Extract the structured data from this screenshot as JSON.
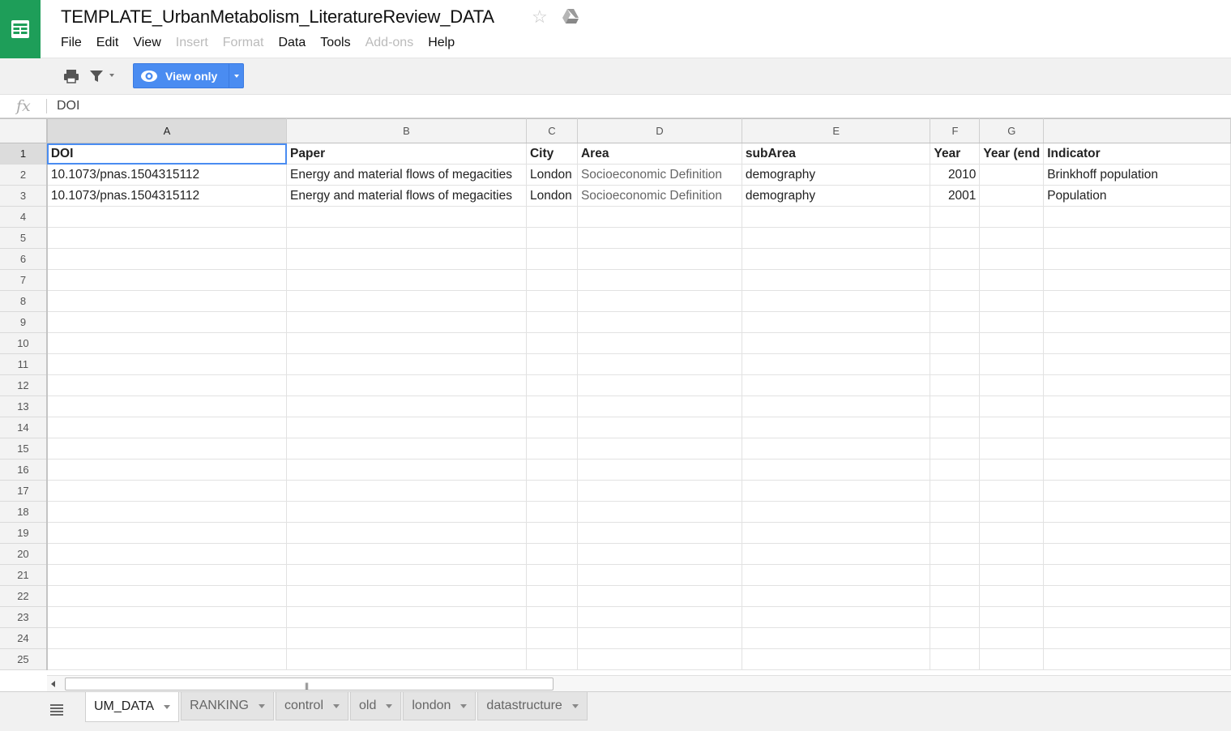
{
  "document": {
    "title": "TEMPLATE_UrbanMetabolism_LiteratureReview_DATA"
  },
  "menu": [
    {
      "label": "File",
      "disabled": false
    },
    {
      "label": "Edit",
      "disabled": false
    },
    {
      "label": "View",
      "disabled": false
    },
    {
      "label": "Insert",
      "disabled": true
    },
    {
      "label": "Format",
      "disabled": true
    },
    {
      "label": "Data",
      "disabled": false
    },
    {
      "label": "Tools",
      "disabled": false
    },
    {
      "label": "Add-ons",
      "disabled": true
    },
    {
      "label": "Help",
      "disabled": false
    }
  ],
  "toolbar": {
    "icons": [
      "print-icon",
      "filter-icon"
    ],
    "view_only_label": "View only",
    "accent_color": "#4a8cf1"
  },
  "formula_bar": {
    "fx_label": "fx",
    "value": "DOI"
  },
  "grid": {
    "columns": [
      "A",
      "B",
      "C",
      "D",
      "E",
      "F",
      "G",
      ""
    ],
    "selected_column": "A",
    "selected_row": "1",
    "row_numbers": [
      "1",
      "2",
      "3",
      "4",
      "5",
      "6",
      "7",
      "8",
      "9",
      "10",
      "11",
      "12",
      "13",
      "14",
      "15",
      "16",
      "17",
      "18",
      "19",
      "20",
      "21",
      "22",
      "23",
      "24",
      "25"
    ],
    "rows": [
      [
        "DOI",
        "Paper",
        "City",
        "Area",
        "subArea",
        "Year",
        "Year (end",
        "Indicator"
      ],
      [
        "10.1073/pnas.1504315112",
        "Energy and material flows of megacities",
        "London",
        "Socioeconomic Definition",
        "demography",
        "2010",
        "",
        "Brinkhoff population"
      ],
      [
        "10.1073/pnas.1504315112",
        "Energy and material flows of megacities",
        "London",
        "Socioeconomic Definition",
        "demography",
        "2001",
        "",
        "Population"
      ]
    ]
  },
  "sheet_tabs": [
    {
      "label": "UM_DATA",
      "active": true
    },
    {
      "label": "RANKING",
      "active": false
    },
    {
      "label": "control",
      "active": false
    },
    {
      "label": "old",
      "active": false
    },
    {
      "label": "london",
      "active": false
    },
    {
      "label": "datastructure",
      "active": false
    }
  ],
  "brand_color": "#1e9e59"
}
